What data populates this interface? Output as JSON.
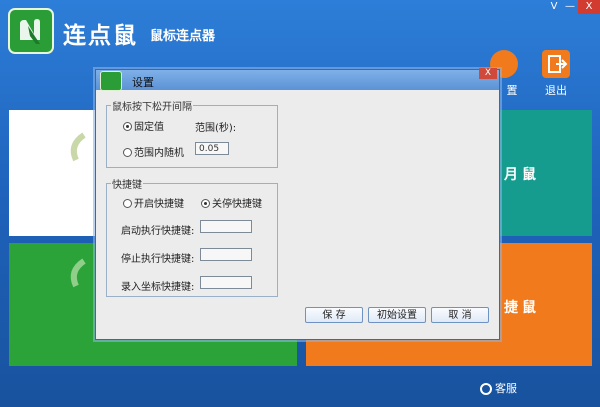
{
  "app": {
    "title": "连点鼠",
    "subtitle": "鼠标连点器",
    "window_controls": [
      "V",
      "—",
      "X"
    ],
    "toolbar": {
      "settings_label": "置",
      "exit_label": "退出"
    },
    "tiles": {
      "right_top_label": "月鼠",
      "right_bottom_label": "捷鼠"
    },
    "support_label": "客服",
    "colors": {
      "background": "#1f64bd",
      "tile_teal": "#169c8f",
      "tile_green": "#2ba339",
      "tile_orange": "#f07a1c",
      "tile_white": "#ffffff"
    }
  },
  "dialog": {
    "title": "设置",
    "close_label": "X",
    "interval_group": {
      "title": "鼠标按下松开间隔",
      "fixed_label": "固定值",
      "range_caption": "范围(秒):",
      "random_label": "范围内随机",
      "value": "0.05",
      "selected": "fixed"
    },
    "hotkey_group": {
      "title": "快捷键",
      "enable_label": "开启快捷键",
      "disable_label": "关停快捷键",
      "selected": "disable",
      "start_label": "启动执行快捷键:",
      "stop_label": "停止执行快捷键:",
      "record_label": "录入坐标快捷键:",
      "start_value": "",
      "stop_value": "",
      "record_value": ""
    },
    "buttons": {
      "save": "保 存",
      "init": "初始设置",
      "cancel": "取 消"
    }
  }
}
